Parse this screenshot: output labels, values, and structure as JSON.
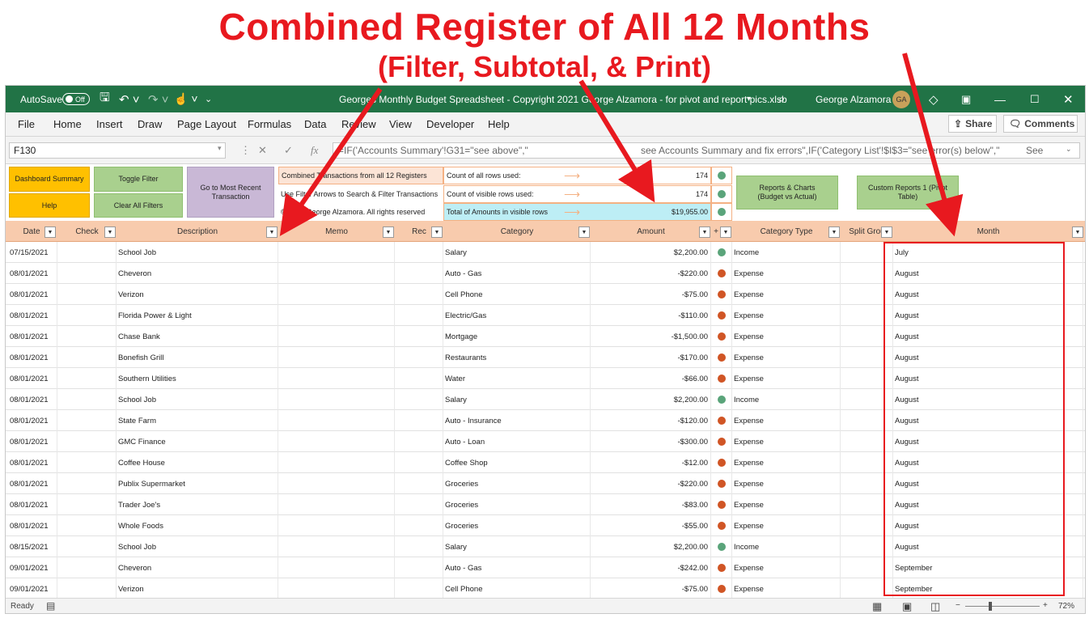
{
  "headline": {
    "title": "Combined Register of All 12 Months",
    "subtitle": "(Filter, Subtotal, & Print)"
  },
  "titlebar": {
    "autosave": "AutoSave",
    "autosave_state": "Off",
    "doc_title": "Georges Monthly Budget Spreadsheet - Copyright 2021 George Alzamora - for pivot and report pics.xlsb",
    "user": "George Alzamora",
    "initials": "GA"
  },
  "menu": {
    "items": [
      "File",
      "Home",
      "Insert",
      "Draw",
      "Page Layout",
      "Formulas",
      "Data",
      "Review",
      "View",
      "Developer",
      "Help"
    ],
    "share": "Share",
    "comments": "Comments"
  },
  "formula": {
    "namebox": "F130",
    "text1": "=IF('Accounts Summary'!G31=\"see above\",\"",
    "text2": "see Accounts Summary and fix errors\",IF('Category List'!$I$3=\"see error(s) below\",\"",
    "text3": "See"
  },
  "dashboard": {
    "btn_dashboard": "Dashboard Summary",
    "btn_help": "Help",
    "btn_toggle": "Toggle Filter",
    "btn_clear": "Clear All Filters",
    "btn_recent": "Go to Most Recent Transaction",
    "info1": "Combined Transactions from all 12 Registers",
    "info2": "Use Filter Arrows to Search & Filter Transactions",
    "info3": "© 2021 George Alzamora. All rights reserved",
    "count_all_label": "Count of all rows used:",
    "count_visible_label": "Count of visible rows used:",
    "total_label": "Total of Amounts in visible rows",
    "count_all": "174",
    "count_visible": "174",
    "total": "$19,955.00",
    "btn_reports": "Reports & Charts (Budget vs Actual)",
    "btn_custom": "Custom Reports 1 (Pivot Table)"
  },
  "columns": {
    "date": "Date",
    "check": "Check",
    "description": "Description",
    "memo": "Memo",
    "rec": "Rec",
    "category": "Category",
    "amount": "Amount",
    "flag": "+",
    "category_type": "Category Type",
    "split_group": "Split Grou",
    "month": "Month"
  },
  "rows": [
    {
      "date": "07/15/2021",
      "description": "School Job",
      "category": "Salary",
      "amount": "$2,200.00",
      "type": "Income",
      "month": "July"
    },
    {
      "date": "08/01/2021",
      "description": "Cheveron",
      "category": "Auto - Gas",
      "amount": "-$220.00",
      "type": "Expense",
      "month": "August"
    },
    {
      "date": "08/01/2021",
      "description": "Verizon",
      "category": "Cell Phone",
      "amount": "-$75.00",
      "type": "Expense",
      "month": "August"
    },
    {
      "date": "08/01/2021",
      "description": "Florida Power & Light",
      "category": "Electric/Gas",
      "amount": "-$110.00",
      "type": "Expense",
      "month": "August"
    },
    {
      "date": "08/01/2021",
      "description": "Chase Bank",
      "category": "Mortgage",
      "amount": "-$1,500.00",
      "type": "Expense",
      "month": "August"
    },
    {
      "date": "08/01/2021",
      "description": "Bonefish Grill",
      "category": "Restaurants",
      "amount": "-$170.00",
      "type": "Expense",
      "month": "August"
    },
    {
      "date": "08/01/2021",
      "description": "Southern Utilities",
      "category": "Water",
      "amount": "-$66.00",
      "type": "Expense",
      "month": "August"
    },
    {
      "date": "08/01/2021",
      "description": "School Job",
      "category": "Salary",
      "amount": "$2,200.00",
      "type": "Income",
      "month": "August"
    },
    {
      "date": "08/01/2021",
      "description": "State Farm",
      "category": "Auto - Insurance",
      "amount": "-$120.00",
      "type": "Expense",
      "month": "August"
    },
    {
      "date": "08/01/2021",
      "description": "GMC Finance",
      "category": "Auto - Loan",
      "amount": "-$300.00",
      "type": "Expense",
      "month": "August"
    },
    {
      "date": "08/01/2021",
      "description": "Coffee House",
      "category": "Coffee Shop",
      "amount": "-$12.00",
      "type": "Expense",
      "month": "August"
    },
    {
      "date": "08/01/2021",
      "description": "Publix Supermarket",
      "category": "Groceries",
      "amount": "-$220.00",
      "type": "Expense",
      "month": "August"
    },
    {
      "date": "08/01/2021",
      "description": "Trader Joe's",
      "category": "Groceries",
      "amount": "-$83.00",
      "type": "Expense",
      "month": "August"
    },
    {
      "date": "08/01/2021",
      "description": "Whole Foods",
      "category": "Groceries",
      "amount": "-$55.00",
      "type": "Expense",
      "month": "August"
    },
    {
      "date": "08/15/2021",
      "description": "School Job",
      "category": "Salary",
      "amount": "$2,200.00",
      "type": "Income",
      "month": "August"
    },
    {
      "date": "09/01/2021",
      "description": "Cheveron",
      "category": "Auto - Gas",
      "amount": "-$242.00",
      "type": "Expense",
      "month": "September"
    },
    {
      "date": "09/01/2021",
      "description": "Verizon",
      "category": "Cell Phone",
      "amount": "-$75.00",
      "type": "Expense",
      "month": "September"
    }
  ],
  "status": {
    "ready": "Ready",
    "zoom": "72%"
  },
  "colors": {
    "accent": "#217346",
    "annotation": "#e8191f",
    "income_dot": "#5aa47a",
    "expense_dot": "#d05525"
  }
}
